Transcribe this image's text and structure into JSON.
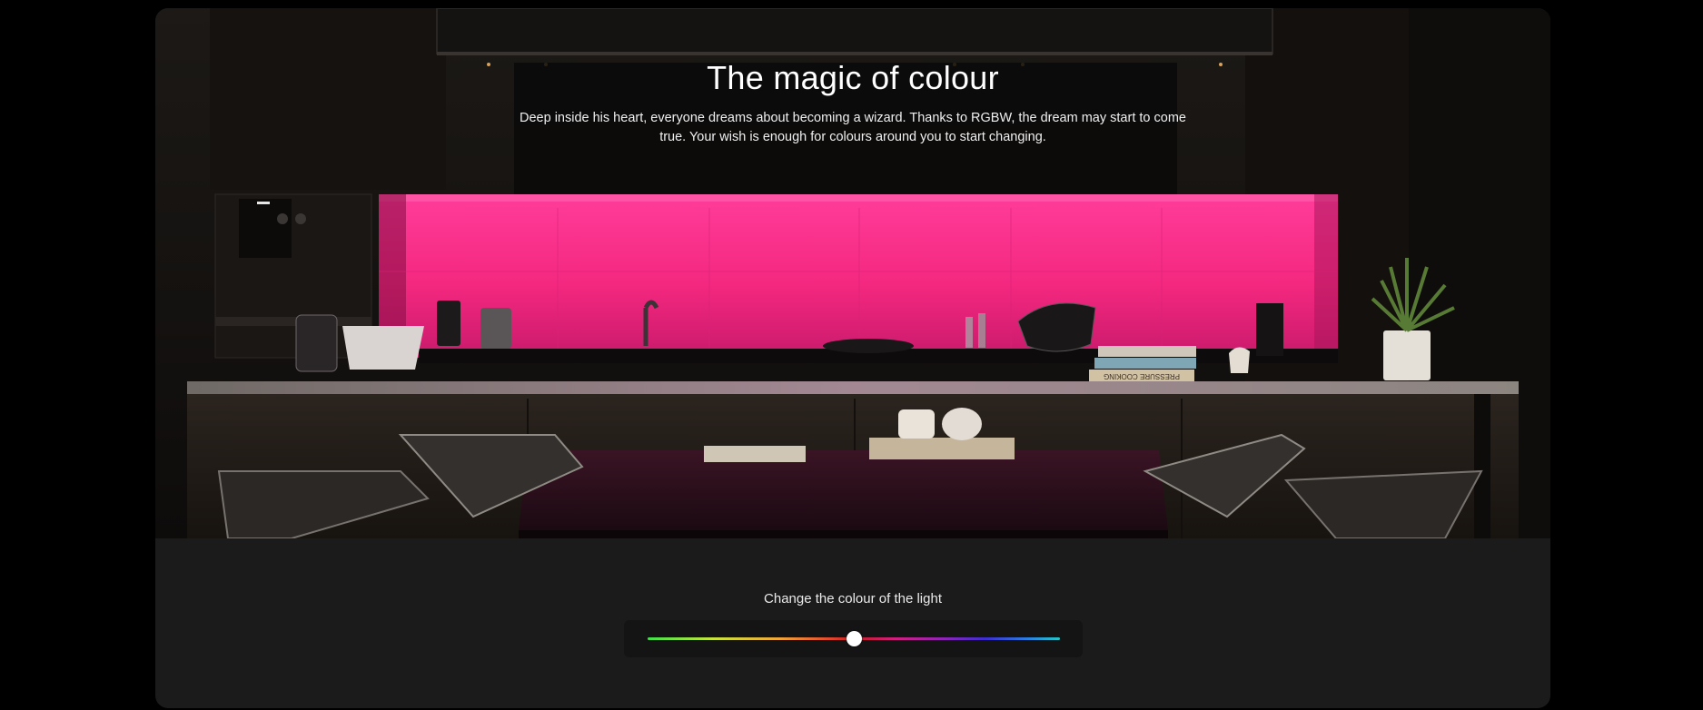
{
  "hero": {
    "title": "The magic of colour",
    "description": "Deep inside his heart, everyone dreams about becoming a wizard. Thanks to RGBW, the dream may start to come true. Your wish is enough for colours around you to start changing.",
    "book_spine_text": "PRESSURE COOKING",
    "backsplash_color": "#ff2a8f"
  },
  "control": {
    "label": "Change the colour of the light",
    "slider_position_fraction": 0.5
  }
}
